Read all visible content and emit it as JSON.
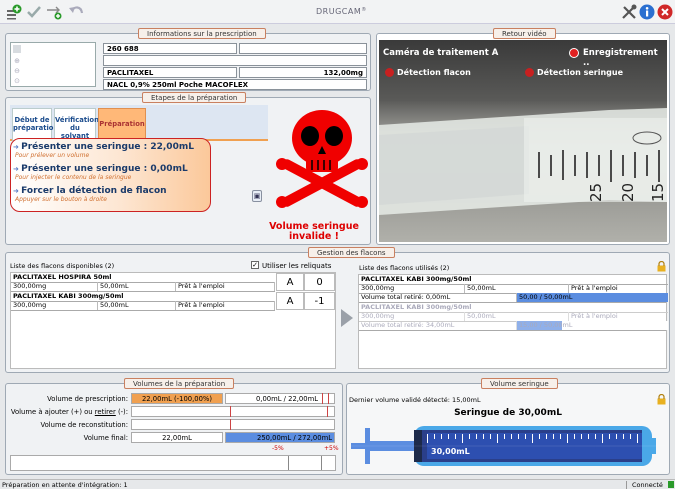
{
  "brand": {
    "logo_text": "DRUGCAM",
    "reg": "®"
  },
  "prescription": {
    "legend": "Informations sur la prescription",
    "field1": "260 688",
    "drug": "PACLITAXEL",
    "dose": "132,00mg",
    "solvent": "NACL 0,9% 250ml Poche MACOFLEX"
  },
  "video": {
    "legend": "Retour vidéo",
    "camera": "Caméra de traitement A",
    "recording": "Enregistrement ..",
    "detect_vial": "Détection flacon",
    "detect_syringe": "Détection seringue"
  },
  "steps": {
    "legend": "Etapes de la préparation",
    "tabs": [
      {
        "line1": "Début de",
        "line2": "préparation"
      },
      {
        "line1": "Vérification",
        "line2": "du solvant"
      },
      {
        "line1": "Préparation",
        "line2": ""
      }
    ],
    "instructions": [
      {
        "title": "Présenter une seringue : 22,00mL",
        "sub": "Pour prélever un volume"
      },
      {
        "title": "Présenter une seringue : 0,00mL",
        "sub": "Pour injecter le contenu de la seringue"
      },
      {
        "title": "Forcer la détection de flacon",
        "sub": "Appuyer sur le bouton à droite"
      }
    ],
    "alert_line1": "Volume seringue",
    "alert_line2": "invalide !"
  },
  "vials": {
    "legend": "Gestion des flacons",
    "available_title": "Liste des flacons disponibles (2)",
    "use_leftovers": "Utiliser les reliquats",
    "available": [
      {
        "name": "PACLITAXEL HOSPIRA 50ml",
        "qty": "300,00mg",
        "vol": "50,00mL",
        "status": "Prêt à l'emploi",
        "type": "A",
        "count": "0"
      },
      {
        "name": "PACLITAXEL KABI 300mg/50ml",
        "qty": "300,00mg",
        "vol": "50,00mL",
        "status": "Prêt à l'emploi",
        "type": "A",
        "count": "-1"
      }
    ],
    "used_title": "Liste des flacons utilisés (2)",
    "used": [
      {
        "name": "PACLITAXEL KABI 300mg/50ml",
        "qty": "300,00mg",
        "vol": "50,00mL",
        "status": "Prêt à l'emploi",
        "total": "Volume total retiré: 0,00mL",
        "ratio": "50,00 / 50,00mL",
        "fill": 1.0,
        "disabled": false
      },
      {
        "name": "PACLITAXEL KABI 300mg/50ml",
        "qty": "300,00mg",
        "vol": "50,00mL",
        "status": "Prêt à l'emploi",
        "total": "Volume total retiré: 34,00mL",
        "ratio": "15,00 / 50,00mL",
        "fill": 0.3,
        "disabled": true
      }
    ]
  },
  "volumes": {
    "legend": "Volumes de la préparation",
    "presc_label": "Volume de prescription:",
    "presc_value": "22,00mL (-100,00%)",
    "presc_ratio": "0,00mL / 22,00mL",
    "add_label_pre": "Volume à ajouter (+) ou ",
    "add_label_u": "retirer",
    "add_label_post": " (-):",
    "recon_label": "Volume de reconstitution:",
    "final_label": "Volume final:",
    "final_value": "22,00mL",
    "final_ratio": "250,00mL / 272,00mL",
    "minus": "-5%",
    "plus": "+5%"
  },
  "syringe": {
    "legend": "Volume seringue",
    "last": "Dernier volume validé détecté: 15,00mL",
    "title": "Seringue de 30,00mL",
    "value": "30,00mL"
  },
  "status": {
    "left": "Préparation en attente d'intégration: 1",
    "right": "Connecté"
  },
  "colors": {
    "accent": "#f0a050",
    "blue": "#5b8de0",
    "red": "#cc0000",
    "tab_active": "#ffb878"
  }
}
